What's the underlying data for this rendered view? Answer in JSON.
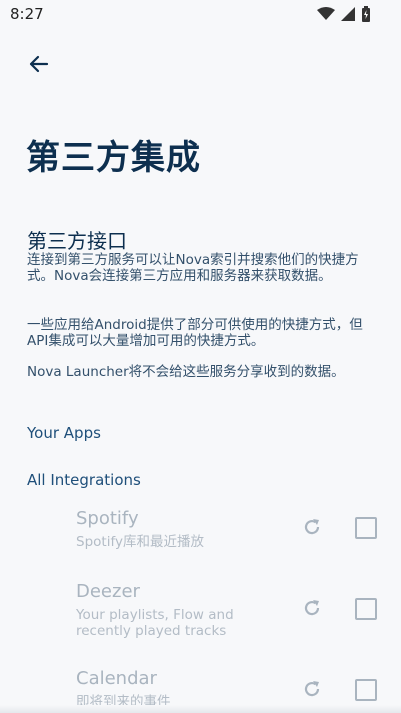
{
  "status": {
    "time": "8:27"
  },
  "page": {
    "title": "第三方集成",
    "section_title": "第三方接口",
    "paragraphs": [
      "连接到第三方服务可以让Nova索引并搜索他们的快捷方式。Nova会连接第三方应用和服务器来获取数据。",
      "一些应用给Android提供了部分可供使用的快捷方式，但API集成可以大量增加可用的快捷方式。",
      "Nova Launcher将不会给这些服务分享收到的数据。"
    ],
    "category_your_apps": "Your Apps",
    "category_all": "All Integrations"
  },
  "integrations": [
    {
      "title": "Spotify",
      "subtitle": "Spotify库和最近播放",
      "checked": false
    },
    {
      "title": "Deezer",
      "subtitle": "Your playlists, Flow and recently played tracks",
      "checked": false
    },
    {
      "title": "Calendar",
      "subtitle": "即将到来的事件",
      "checked": false
    }
  ],
  "colors": {
    "accent": "#0d2f4f",
    "disabled": "#a9b4bf",
    "background": "#f7f8fa"
  }
}
